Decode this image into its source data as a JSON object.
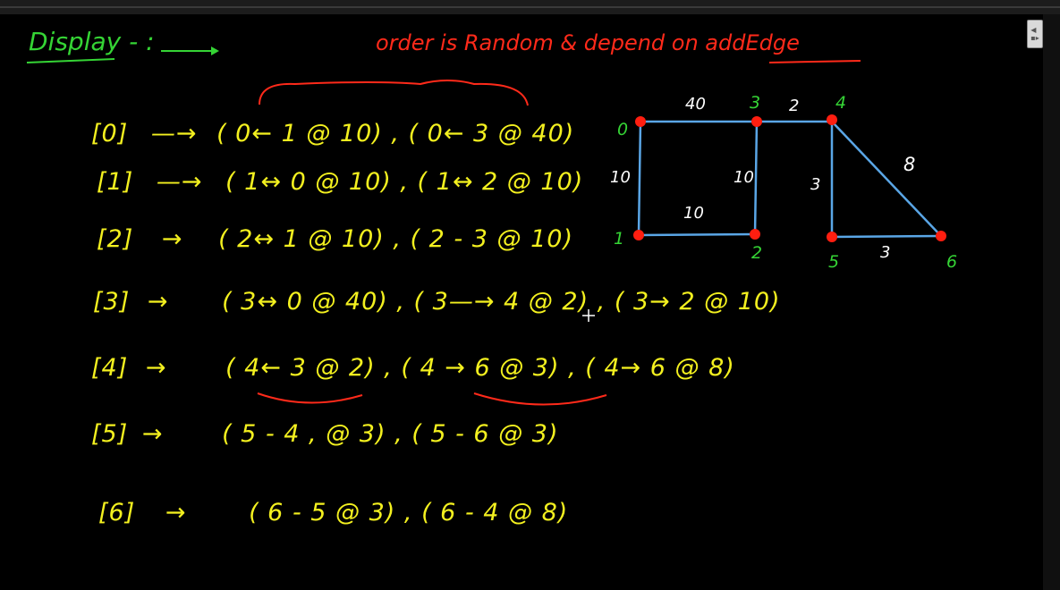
{
  "header": {
    "display_label": "Display - :",
    "note": "order is Random & depend on addEdge"
  },
  "adjacency_list": [
    {
      "index": "[0]",
      "arrow": "—→",
      "edges": "( 0← 1 @ 10) , ( 0← 3 @ 40)"
    },
    {
      "index": "[1]",
      "arrow": "—→",
      "edges": "( 1↔ 0  @ 10) , ( 1↔ 2 @ 10)"
    },
    {
      "index": "[2]",
      "arrow": "→",
      "edges": "( 2↔ 1  @  10) , ( 2 - 3  @ 10)"
    },
    {
      "index": "[3]",
      "arrow": "→",
      "edges": "( 3↔ 0  @ 40) , ( 3—→ 4 @ 2) , ( 3→ 2 @ 10)"
    },
    {
      "index": "[4]",
      "arrow": "→",
      "edges": "( 4← 3  @ 2) , ( 4 → 6  @ 3) , ( 4→ 6 @ 8)"
    },
    {
      "index": "[5]",
      "arrow": "→",
      "edges": "( 5 - 4 , @ 3)  , ( 5 - 6  @  3)"
    },
    {
      "index": "[6]",
      "arrow": "→",
      "edges": "( 6 - 5 @ 3) ,  ( 6 - 4  @ 8)"
    }
  ],
  "graph": {
    "vertices": [
      {
        "label": "0"
      },
      {
        "label": "1"
      },
      {
        "label": "2"
      },
      {
        "label": "3"
      },
      {
        "label": "4"
      },
      {
        "label": "5"
      },
      {
        "label": "6"
      }
    ],
    "edge_weights": [
      {
        "label": "40"
      },
      {
        "label": "2"
      },
      {
        "label": "10"
      },
      {
        "label": "10"
      },
      {
        "label": "10"
      },
      {
        "label": "3"
      },
      {
        "label": "8"
      },
      {
        "label": "3"
      }
    ]
  },
  "colors": {
    "background": "#000000",
    "text_yellow": "#f3f01f",
    "text_red": "#ff2a1a",
    "text_green": "#35d435",
    "edge_blue": "#5aa6e6",
    "vertex_red": "#ff1e10"
  }
}
